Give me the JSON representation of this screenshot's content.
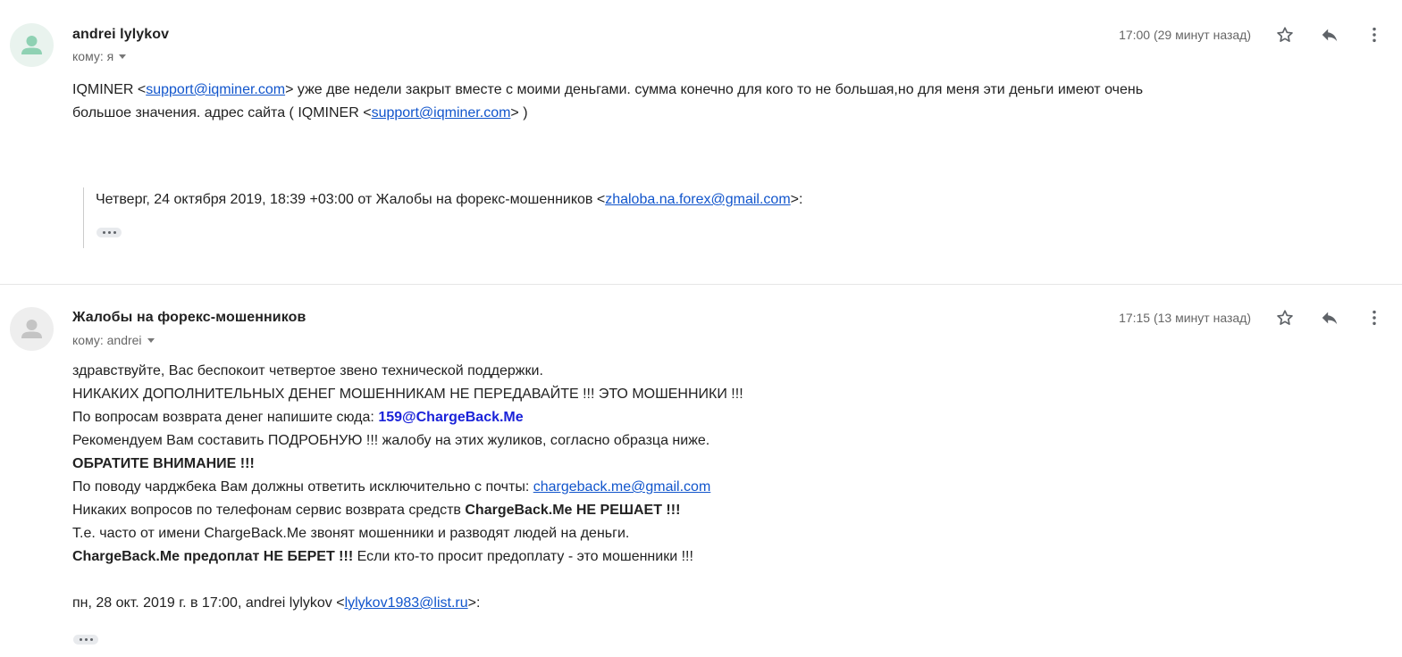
{
  "message1": {
    "sender": "andrei lylykov",
    "to": "кому: я",
    "time": "17:00 (29 минут назад)",
    "body": {
      "p1_a": "IQMINER <",
      "p1_link": "support@iqminer.com",
      "p1_b": ">  уже две недели закрыт вместе с моими деньгами. сумма конечно для кого то не большая,но для меня эти деньги имеют очень",
      "p2_a": "большое значения. адрес сайта  (  IQMINER <",
      "p2_link": "support@iqminer.com",
      "p2_b": ">  )"
    },
    "quote": {
      "prefix": "Четверг, 24 октября 2019, 18:39 +03:00 от Жалобы на форекс-мошенников <",
      "link": "zhaloba.na.forex@gmail.com",
      "suffix": ">:"
    }
  },
  "message2": {
    "sender": "Жалобы на форекс-мошенников",
    "to": "кому: andrei",
    "time": "17:15 (13 минут назад)",
    "body": {
      "l1": "здравствуйте, Вас беспокоит четвертое звено технической поддержки.",
      "l2": "НИКАКИХ ДОПОЛНИТЕЛЬНЫХ ДЕНЕГ МОШЕННИКАМ НЕ ПЕРЕДАВАЙТЕ !!! ЭТО МОШЕННИКИ !!!",
      "l3_a": "По вопросам возврата денег напишите сюда: ",
      "l3_link": "159@ChargeBack.Me",
      "l4": "Рекомендуем Вам составить ПОДРОБНУЮ !!! жалобу на этих жуликов, согласно образца ниже.",
      "l5": "ОБРАТИТЕ ВНИМАНИЕ !!!",
      "l6_a": "По поводу чарджбека Вам должны ответить исключительно с почты: ",
      "l6_link": "chargeback.me@gmail.com",
      "l7_a": "Никаких вопросов по телефонам сервис возврата средств ",
      "l7_b": "ChargeBack.Me НЕ РЕШАЕТ !!!",
      "l8": "Т.е. часто от имени ChargeBack.Me звонят мошенники и разводят людей на деньги.",
      "l9_a": "ChargeBack.Me предоплат НЕ БЕРЕТ !!!",
      "l9_b": " Если кто-то просит предоплату - это мошенники !!!",
      "l10_a": "пн, 28 окт. 2019 г. в 17:00, andrei lylykov <",
      "l10_link": "lylykov1983@list.ru",
      "l10_b": ">:"
    }
  },
  "icons": {
    "avatar": "person-icon",
    "star": "star-icon",
    "reply": "reply-icon",
    "more": "more-vert-icon",
    "trimmed": "ellipsis-icon"
  },
  "colors": {
    "link": "#1155cc",
    "bold_link": "#1a22d9",
    "avatar_green": "#8fd1b3",
    "avatar_grey": "#c4c4c4"
  }
}
